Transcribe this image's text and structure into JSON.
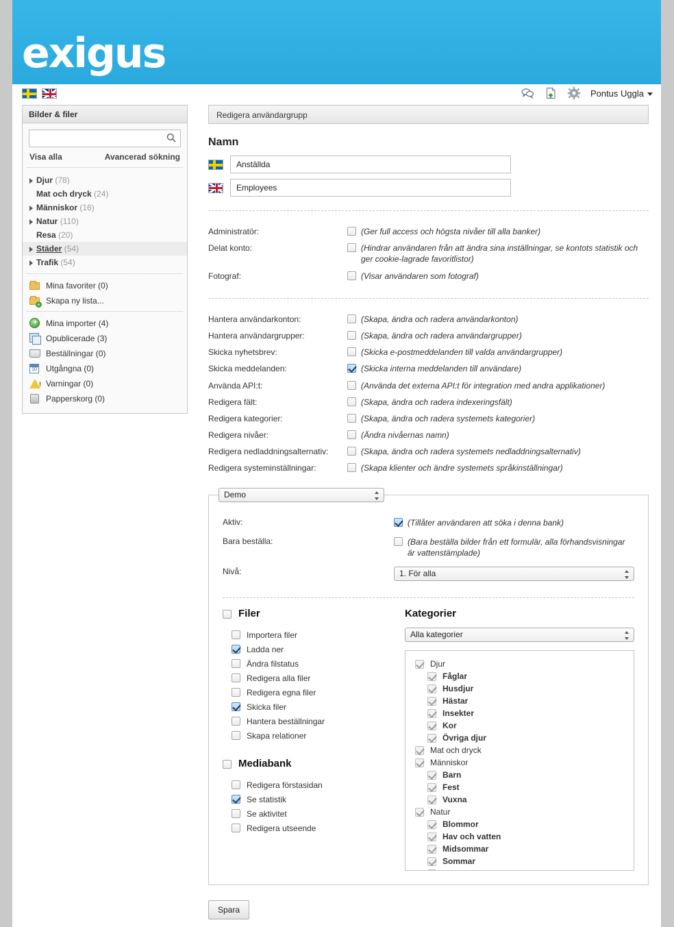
{
  "brand": {
    "logo_text": "exigus"
  },
  "topbar": {
    "icons": [
      {
        "name": "messages-icon"
      },
      {
        "name": "upload-document-icon"
      },
      {
        "name": "settings-gear-icon"
      }
    ],
    "username": "Pontus Uggla",
    "languages": [
      {
        "name": "swedish-flag",
        "label": "Svenska"
      },
      {
        "name": "english-flag",
        "label": "English"
      }
    ]
  },
  "sidebar": {
    "header": "Bilder & filer",
    "search": {
      "value": "",
      "placeholder": ""
    },
    "links": {
      "show_all": "Visa alla",
      "advanced": "Avancerad sökning"
    },
    "categories": [
      {
        "label": "Djur",
        "count": "(78)",
        "expandable": true,
        "selected": false
      },
      {
        "label": "Mat och dryck",
        "count": "(24)",
        "expandable": false,
        "selected": false
      },
      {
        "label": "Människor",
        "count": "(16)",
        "expandable": true,
        "selected": false
      },
      {
        "label": "Natur",
        "count": "(110)",
        "expandable": true,
        "selected": false
      },
      {
        "label": "Resa",
        "count": "(20)",
        "expandable": false,
        "selected": false
      },
      {
        "label": "Städer",
        "count": "(54)",
        "expandable": true,
        "selected": true
      },
      {
        "label": "Trafik",
        "count": "(54)",
        "expandable": true,
        "selected": false
      }
    ],
    "lists_group_1": [
      {
        "label": "Mina favoriter (0)",
        "icon": "folder-icon"
      },
      {
        "label": "Skapa ny lista...",
        "icon": "new-folder-icon"
      }
    ],
    "lists_group_2": [
      {
        "label": "Mina importer (4)",
        "icon": "green-plus-icon"
      },
      {
        "label": "Opublicerade (3)",
        "icon": "stacked-images-icon"
      },
      {
        "label": "Beställningar (0)",
        "icon": "shopping-cart-icon"
      },
      {
        "label": "Utgångna (0)",
        "icon": "calendar-icon"
      },
      {
        "label": "Varningar (0)",
        "icon": "warning-triangle-icon"
      },
      {
        "label": "Papperskorg (0)",
        "icon": "trash-bin-icon"
      }
    ]
  },
  "main": {
    "header": "Redigera användargrupp",
    "name_section_title": "Namn",
    "names": [
      {
        "lang": "swedish-flag",
        "value": "Anställda"
      },
      {
        "lang": "english-flag",
        "value": "Employees"
      }
    ],
    "permissions_group_1": [
      {
        "label": "Administratör:",
        "checked": false,
        "note": "(Ger full access och högsta nivåer till alla banker)"
      },
      {
        "label": "Delat konto:",
        "checked": false,
        "note": "(Hindrar användaren från att ändra sina inställningar, se kontots statistik och ger cookie-lagrade favoritlistor)"
      },
      {
        "label": "Fotograf:",
        "checked": false,
        "note": "(Visar användaren som fotograf)"
      }
    ],
    "permissions_group_2": [
      {
        "label": "Hantera användarkonton:",
        "checked": false,
        "note": "(Skapa, ändra och radera användarkonton)"
      },
      {
        "label": "Hantera användargrupper:",
        "checked": false,
        "note": "(Skapa, ändra och radera användargrupper)"
      },
      {
        "label": "Skicka nyhetsbrev:",
        "checked": false,
        "note": "(Skicka e-postmeddelanden till valda användargrupper)"
      },
      {
        "label": "Skicka meddelanden:",
        "checked": true,
        "note": "(Skicka interna meddelanden till användare)"
      },
      {
        "label": "Använda API:t:",
        "checked": false,
        "note": "(Använda det externa API:t för integration med andra applikationer)"
      },
      {
        "label": "Redigera fält:",
        "checked": false,
        "note": "(Skapa, ändra och radera indexeringsfält)"
      },
      {
        "label": "Redigera kategorier:",
        "checked": false,
        "note": "(Skapa, ändra och radera systemets kategorier)"
      },
      {
        "label": "Redigera nivåer:",
        "checked": false,
        "note": "(Ändra nivåernas namn)"
      },
      {
        "label": "Redigera nedladdningsalternativ:",
        "checked": false,
        "note": "(Skapa, ändra och radera systemets nedladdningsalternativ)"
      },
      {
        "label": "Redigera systeminställningar:",
        "checked": false,
        "note": "(Skapa klienter och ändre systemets språkinställningar)"
      }
    ],
    "bank": {
      "selected_bank": "Demo",
      "rows": [
        {
          "label": "Aktiv:",
          "checked": true,
          "note": "(Tillåter användaren att söka i denna bank)"
        },
        {
          "label": "Bara beställa:",
          "checked": false,
          "note": "(Bara beställa bilder från ett formulär, alla förhandsvisningar är vattenstämplade)"
        }
      ],
      "level_label": "Nivå:",
      "level_value": "1. För alla",
      "files": {
        "title": "Filer",
        "title_checked": false,
        "options": [
          {
            "label": "Importera filer",
            "checked": false
          },
          {
            "label": "Ladda ner",
            "checked": true
          },
          {
            "label": "Ändra filstatus",
            "checked": false
          },
          {
            "label": "Redigera alla filer",
            "checked": false
          },
          {
            "label": "Redigera egna filer",
            "checked": false
          },
          {
            "label": "Skicka filer",
            "checked": true
          },
          {
            "label": "Hantera beställningar",
            "checked": false
          },
          {
            "label": "Skapa relationer",
            "checked": false
          }
        ]
      },
      "mediabank": {
        "title": "Mediabank",
        "title_checked": false,
        "options": [
          {
            "label": "Redigera förstasidan",
            "checked": false
          },
          {
            "label": "Se statistik",
            "checked": true
          },
          {
            "label": "Se aktivitet",
            "checked": false
          },
          {
            "label": "Redigera utseende",
            "checked": false
          }
        ]
      },
      "categories": {
        "title": "Kategorier",
        "filter_value": "Alla kategorier",
        "tree": [
          {
            "label": "Djur",
            "level": 0,
            "checked": true,
            "disabled": true
          },
          {
            "label": "Fåglar",
            "level": 1,
            "checked": true,
            "disabled": true
          },
          {
            "label": "Husdjur",
            "level": 1,
            "checked": true,
            "disabled": true
          },
          {
            "label": "Hästar",
            "level": 1,
            "checked": true,
            "disabled": true
          },
          {
            "label": "Insekter",
            "level": 1,
            "checked": true,
            "disabled": true
          },
          {
            "label": "Kor",
            "level": 1,
            "checked": true,
            "disabled": true
          },
          {
            "label": "Övriga djur",
            "level": 1,
            "checked": true,
            "disabled": true
          },
          {
            "label": "Mat och dryck",
            "level": 0,
            "checked": true,
            "disabled": true
          },
          {
            "label": "Människor",
            "level": 0,
            "checked": true,
            "disabled": true
          },
          {
            "label": "Barn",
            "level": 1,
            "checked": true,
            "disabled": true
          },
          {
            "label": "Fest",
            "level": 1,
            "checked": true,
            "disabled": true
          },
          {
            "label": "Vuxna",
            "level": 1,
            "checked": true,
            "disabled": true
          },
          {
            "label": "Natur",
            "level": 0,
            "checked": true,
            "disabled": true
          },
          {
            "label": "Blommor",
            "level": 1,
            "checked": true,
            "disabled": true
          },
          {
            "label": "Hav och vatten",
            "level": 1,
            "checked": true,
            "disabled": true
          },
          {
            "label": "Midsommar",
            "level": 1,
            "checked": true,
            "disabled": true
          },
          {
            "label": "Sommar",
            "level": 1,
            "checked": true,
            "disabled": true
          }
        ]
      }
    },
    "save_label": "Spara"
  },
  "colors": {
    "brand_blue": "#2aa9dd",
    "page_bg": "#c9c9c9",
    "checkbox_checked": "#a9d3f5"
  }
}
